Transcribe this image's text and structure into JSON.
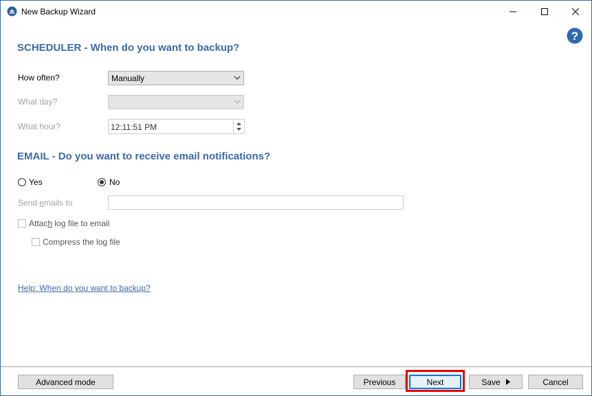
{
  "window": {
    "title": "New Backup Wizard"
  },
  "scheduler": {
    "heading": "SCHEDULER - When do you want to backup?",
    "how_often_label": "How often?",
    "how_often_value": "Manually",
    "what_day_label": "What day?",
    "what_day_value": "",
    "what_hour_label": "What hour?",
    "what_hour_value": "12:11:51 PM"
  },
  "email": {
    "heading": "EMAIL - Do you want to receive email notifications?",
    "yes_label": "Yes",
    "no_label": "No",
    "selected": "No",
    "send_emails_label_pre": "Send ",
    "send_emails_label_mn": "e",
    "send_emails_label_post": "mails to",
    "send_emails_value": "",
    "attach_log_pre": "Attac",
    "attach_log_mn": "h",
    "attach_log_post": " log file to email",
    "compress_log_label": "Compress the log file"
  },
  "help_link": "Help: When do you want to backup?",
  "footer": {
    "advanced_mode": "Advanced mode",
    "previous": "Previous",
    "next": "Next",
    "save": "Save",
    "cancel": "Cancel"
  },
  "colors": {
    "heading": "#3c6aa8",
    "highlight": "#e00000",
    "focus": "#0078d7"
  },
  "icons": [
    "app-icon",
    "minimize-icon",
    "maximize-icon",
    "close-icon",
    "help-icon",
    "chevron-down-icon",
    "spin-up-icon",
    "spin-down-icon",
    "caret-right-icon"
  ]
}
